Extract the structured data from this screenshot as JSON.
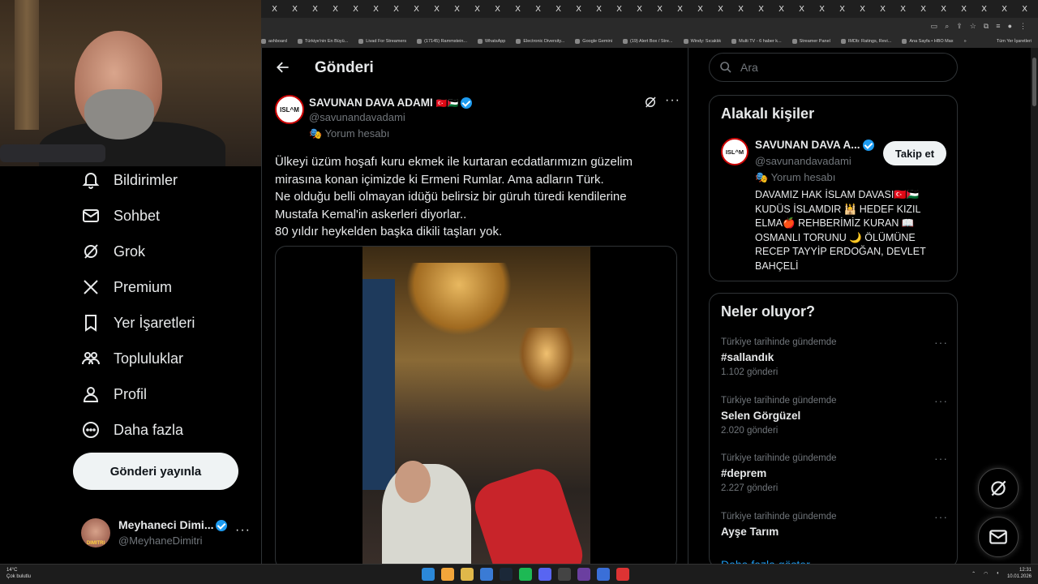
{
  "browser": {
    "tabs": [
      "X",
      "X",
      "X",
      "X",
      "X",
      "X",
      "X",
      "X",
      "X",
      "X",
      "X",
      "X",
      "X",
      "X",
      "X",
      "X",
      "X",
      "X",
      "X",
      "X",
      "X",
      "X",
      "X",
      "X",
      "X",
      "X",
      "X",
      "X",
      "X",
      "X",
      "X",
      "X",
      "X",
      "X",
      "X",
      "X",
      "X",
      "X"
    ],
    "bookmarks": [
      "ashboard",
      "Türkiye'nin En Büyü...",
      "Livad For Streamers",
      "(17145) Rammstein...",
      "WhatsApp",
      "Electronic Diversity...",
      "Google Gemini",
      "(19) Alert Box / Stre...",
      "Windy: Sıcaklık",
      "Multi TV - 6 haber k...",
      "Streamer Panel",
      "IMDb: Ratings, Revi...",
      "Ana Sayfa • HBO Max"
    ],
    "bookmarks_more": "»",
    "all_bookmarks": "Tüm Yer İşaretleri"
  },
  "nav": {
    "items": [
      {
        "label": "Bildirimler",
        "icon": "bell-icon"
      },
      {
        "label": "Sohbet",
        "icon": "mail-icon"
      },
      {
        "label": "Grok",
        "icon": "grok-icon"
      },
      {
        "label": "Premium",
        "icon": "x-logo-icon"
      },
      {
        "label": "Yer İşaretleri",
        "icon": "bookmark-icon"
      },
      {
        "label": "Topluluklar",
        "icon": "people-icon"
      },
      {
        "label": "Profil",
        "icon": "person-icon"
      },
      {
        "label": "Daha fazla",
        "icon": "more-circle-icon"
      }
    ],
    "post_button": "Gönderi yayınla",
    "account": {
      "name": "Meyhaneci Dimi...",
      "handle": "@MeyhaneDimitri",
      "avatar_text": "DIMITRI",
      "more": "···"
    }
  },
  "main": {
    "title": "Gönderi",
    "post": {
      "avatar_text": "ISL^M",
      "author": "SAVUNAN DAVA ADAMI",
      "flags": "🇹🇷🇵🇸",
      "handle": "@savunandavadami",
      "label": "Yorum hesabı",
      "more": "···",
      "lines": [
        "Ülkeyi üzüm hoşafı kuru ekmek ile kurtaran ecdatlarımızın güzelim",
        "mirasına konan içimizde ki Ermeni Rumlar. Ama adların Türk.",
        "Ne olduğu belli olmayan idüğü belirsiz bir güruh türedi kendilerine",
        "Mustafa Kemal'in askerleri diyorlar..",
        "80 yıldır heykelden başka dikili taşları yok."
      ]
    }
  },
  "right": {
    "search_placeholder": "Ara",
    "related": {
      "title": "Alakalı kişiler",
      "avatar_text": "ISL^M",
      "name": "SAVUNAN DAVA A...",
      "handle": "@savunandavadami",
      "label": "Yorum hesabı",
      "follow": "Takip et",
      "bio": "DAVAMIZ HAK İSLAM DAVASI🇹🇷🇵🇸 KUDÜS İSLAMDIR 🕌 HEDEF KIZIL ELMA🍎 REHBERİMİZ KURAN 📖 OSMANLI TORUNU 🌙 ÖLÜMÜNE RECEP TAYYİP ERDOĞAN, DEVLET BAHÇELİ"
    },
    "trends": {
      "title": "Neler oluyor?",
      "items": [
        {
          "context": "Türkiye tarihinde gündemde",
          "name": "#sallandık",
          "count": "1.102 gönderi"
        },
        {
          "context": "Türkiye tarihinde gündemde",
          "name": "Selen Görgüzel",
          "count": "2.020 gönderi"
        },
        {
          "context": "Türkiye tarihinde gündemde",
          "name": "#deprem",
          "count": "2.227 gönderi"
        },
        {
          "context": "Türkiye tarihinde gündemde",
          "name": "Ayşe Tarım",
          "count": ""
        }
      ],
      "show_more": "Daha fazla göster"
    }
  },
  "taskbar": {
    "weather_temp": "14°C",
    "weather_desc": "Çok bulutlu",
    "time": "12:31",
    "date": "10.01.2026"
  },
  "colors": {
    "accent": "#1d9bf0",
    "background": "#000000",
    "text": "#e7e9ea",
    "muted": "#71767b"
  }
}
